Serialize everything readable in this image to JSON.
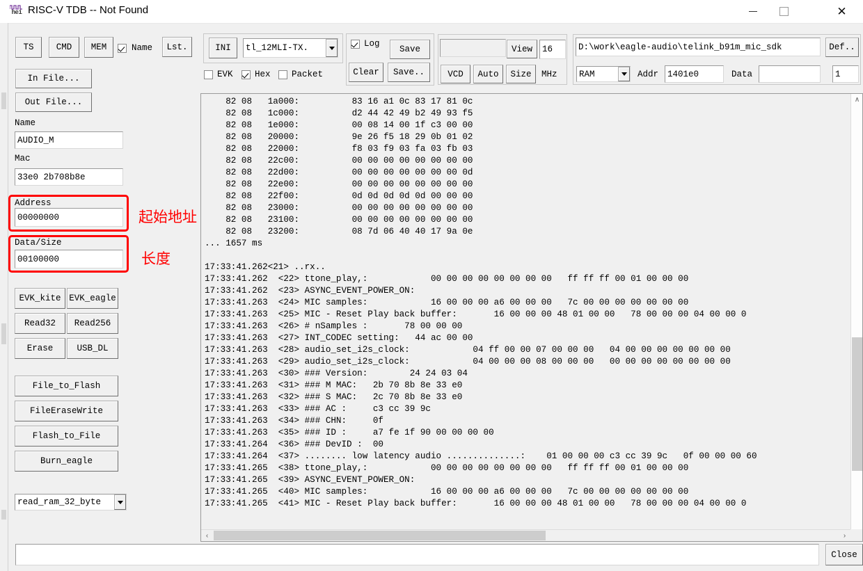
{
  "window": {
    "title": "RISC-V TDB -- Not Found",
    "icon": "hei-logic-icon",
    "minimize_label": "–",
    "maximize_label": "□",
    "close_label": "×"
  },
  "toolbar_left": {
    "buttons": [
      "TS",
      "CMD",
      "MEM",
      "Lst."
    ],
    "name_checkbox": {
      "label": "Name",
      "checked": true
    }
  },
  "sidebar": {
    "in_file_button": "In File...",
    "out_file_button": "Out File...",
    "name_label": "Name",
    "name_value": "AUDIO_M",
    "mac_label": "Mac",
    "mac_value": "33e0 2b708b8e",
    "address_label": "Address",
    "address_value": "00000000",
    "datasize_label": "Data/Size",
    "datasize_value": "00100000",
    "annotations": {
      "address_note": "起始地址",
      "datasize_note": "长度",
      "highlight_color": "#ff0000"
    },
    "buttons_row1": [
      "EVK_kite",
      "EVK_eagle"
    ],
    "buttons_row2": [
      "Read32",
      "Read256"
    ],
    "buttons_row3": [
      "Erase",
      "USB_DL"
    ],
    "buttons_stack": [
      "File_to_Flash",
      "FileEraseWrite",
      "Flash_to_File",
      "Burn_eagle"
    ],
    "script_combo_value": "read_ram_32_byte"
  },
  "ini_group": {
    "ini_button": "INI",
    "ini_combo_value": "tl_12MLI-TX.",
    "checkboxes": [
      {
        "label": "EVK",
        "checked": false
      },
      {
        "label": "Hex",
        "checked": true
      },
      {
        "label": "Packet",
        "checked": false
      }
    ]
  },
  "log_group": {
    "log_checkbox": {
      "label": "Log",
      "checked": true
    },
    "save_button": "Save",
    "clear_button": "Clear",
    "save_dots_button": "Save.."
  },
  "vcd_group": {
    "path_value": "",
    "view_button": "View",
    "view_value": "16",
    "vcd_button": "VCD",
    "auto_button": "Auto",
    "size_button": "Size",
    "mhz_label": "MHz"
  },
  "ram_group": {
    "path_value": "D:\\work\\eagle-audio\\telink_b91m_mic_sdk",
    "def_button": "Def..",
    "mem_combo_value": "RAM",
    "addr_label": "Addr",
    "addr_value": "1401e0",
    "data_label": "Data",
    "data_value": "",
    "count_value": "1"
  },
  "log": {
    "lines": [
      "    82 08   1a000:          83 16 a1 0c 83 17 81 0c",
      "    82 08   1c000:          d2 44 42 49 b2 49 93 f5",
      "    82 08   1e000:          00 08 14 00 1f c3 00 00",
      "    82 08   20000:          9e 26 f5 18 29 0b 01 02",
      "    82 08   22000:          f8 03 f9 03 fa 03 fb 03",
      "    82 08   22c00:          00 00 00 00 00 00 00 00",
      "    82 08   22d00:          00 00 00 00 00 00 00 0d",
      "    82 08   22e00:          00 00 00 00 00 00 00 00",
      "    82 08   22f00:          0d 0d 0d 0d 0d 00 00 00",
      "    82 08   23000:          00 00 00 00 00 00 00 00",
      "    82 08   23100:          00 00 00 00 00 00 00 00",
      "    82 08   23200:          08 7d 06 40 40 17 9a 0e",
      "... 1657 ms",
      "",
      "17:33:41.262<21> ..rx..",
      "17:33:41.262  <22> ttone_play,:            00 00 00 00 00 00 00 00   ff ff ff 00 01 00 00 00",
      "17:33:41.262  <23> ASYNC_EVENT_POWER_ON:",
      "17:33:41.263  <24> MIC samples:            16 00 00 00 a6 00 00 00   7c 00 00 00 00 00 00 00",
      "17:33:41.263  <25> MIC - Reset Play back buffer:       16 00 00 00 48 01 00 00   78 00 00 00 04 00 00 0",
      "17:33:41.263  <26> # nSamples :       78 00 00 00",
      "17:33:41.263  <27> INT_CODEC setting:   44 ac 00 00",
      "17:33:41.263  <28> audio_set_i2s_clock:            04 ff 00 00 07 00 00 00   04 00 00 00 00 00 00 00",
      "17:33:41.263  <29> audio_set_i2s_clock:            04 00 00 00 08 00 00 00   00 00 00 00 00 00 00 00",
      "17:33:41.263  <30> ### Version:        24 24 03 04",
      "17:33:41.263  <31> ### M MAC:   2b 70 8b 8e 33 e0",
      "17:33:41.263  <32> ### S MAC:   2c 70 8b 8e 33 e0",
      "17:33:41.263  <33> ### AC :     c3 cc 39 9c",
      "17:33:41.263  <34> ### CHN:     0f",
      "17:33:41.263  <35> ### ID :     a7 fe 1f 90 00 00 00 00",
      "17:33:41.264  <36> ### DevID :  00",
      "17:33:41.264  <37> ........ low latency audio ..............:    01 00 00 00 c3 cc 39 9c   0f 00 00 00 60",
      "17:33:41.265  <38> ttone_play,:            00 00 00 00 00 00 00 00   ff ff ff 00 01 00 00 00",
      "17:33:41.265  <39> ASYNC_EVENT_POWER_ON:",
      "17:33:41.265  <40> MIC samples:            16 00 00 00 a6 00 00 00   7c 00 00 00 00 00 00 00",
      "17:33:41.265  <41> MIC - Reset Play back buffer:       16 00 00 00 48 01 00 00   78 00 00 00 04 00 00 0"
    ],
    "scrollbar": {
      "up_arrow": "∧",
      "down_arrow": "∨",
      "left_arrow": "‹",
      "right_arrow": "›"
    }
  },
  "bottom": {
    "command_input_value": "",
    "close_button": "Close"
  }
}
